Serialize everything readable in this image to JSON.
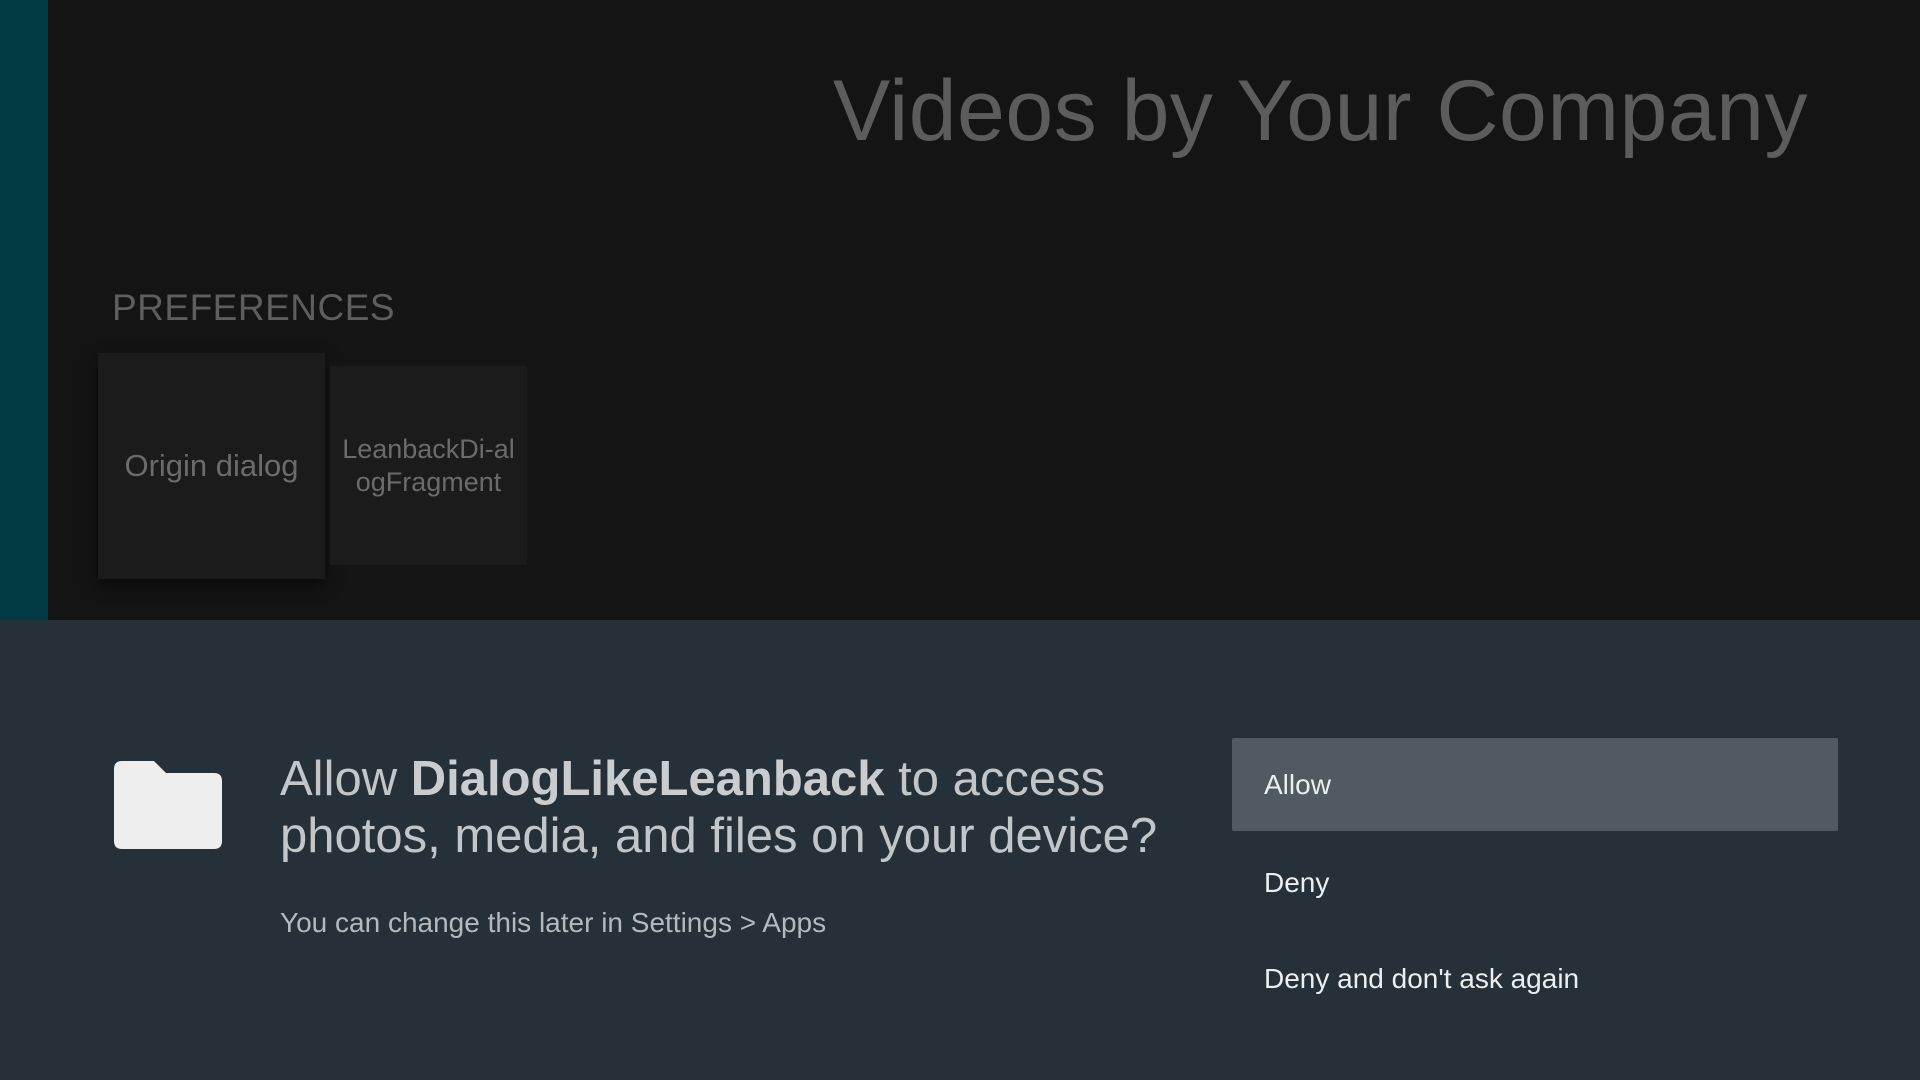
{
  "browse": {
    "title": "Videos by Your Company",
    "row_header": "PREFERENCES",
    "cards": [
      {
        "label": "Origin dialog"
      },
      {
        "label": "LeanbackDi-alogFragment"
      }
    ]
  },
  "dialog": {
    "icon": "folder-icon",
    "message_prefix": "Allow ",
    "app_name": "DialogLikeLeanback",
    "message_suffix": " to access photos, media, and files on your device?",
    "hint": "You can change this later in Settings > Apps",
    "actions": [
      {
        "label": "Allow",
        "focused": true
      },
      {
        "label": "Deny",
        "focused": false
      },
      {
        "label": "Deny and don't ask again",
        "focused": false
      }
    ]
  },
  "colors": {
    "headers_strip": "#013a42",
    "browse_background": "#141414",
    "dialog_background": "#263038",
    "focused_action": "#4f5a61"
  }
}
